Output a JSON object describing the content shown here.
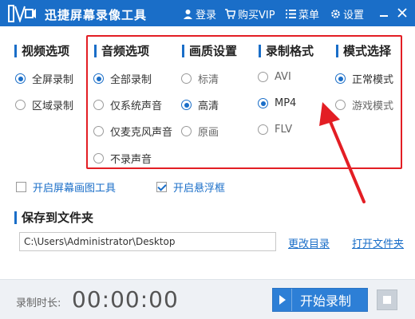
{
  "titlebar": {
    "title": "迅捷屏幕录像工具",
    "login": "登录",
    "vip": "购买VIP",
    "menu": "菜单",
    "settings": "设置"
  },
  "sections": {
    "video": "视频选项",
    "audio": "音频选项",
    "quality": "画质设置",
    "format": "录制格式",
    "mode": "模式选择"
  },
  "video_options": [
    {
      "label": "全屏录制",
      "selected": true
    },
    {
      "label": "区域录制",
      "selected": false
    }
  ],
  "audio_options": [
    {
      "label": "全部录制",
      "selected": true
    },
    {
      "label": "仅系统声音",
      "selected": false
    },
    {
      "label": "仅麦克风声音",
      "selected": false
    },
    {
      "label": "不录声音",
      "selected": false
    }
  ],
  "quality_options": [
    {
      "label": "标清",
      "selected": false
    },
    {
      "label": "高清",
      "selected": true
    },
    {
      "label": "原画",
      "selected": false
    }
  ],
  "format_options": [
    {
      "label": "AVI",
      "selected": false
    },
    {
      "label": "MP4",
      "selected": true
    },
    {
      "label": "FLV",
      "selected": false
    }
  ],
  "mode_options": [
    {
      "label": "正常模式",
      "selected": true
    },
    {
      "label": "游戏模式",
      "selected": false
    }
  ],
  "checkboxes": {
    "draw_tool": {
      "label": "开启屏幕画图工具",
      "checked": false
    },
    "float_window": {
      "label": "开启悬浮框",
      "checked": true
    }
  },
  "folder": {
    "heading": "保存到文件夹",
    "path": "C:\\Users\\Administrator\\Desktop",
    "change": "更改目录",
    "open": "打开文件夹"
  },
  "bottom": {
    "duration_label": "录制时长:",
    "duration": "00:00:00",
    "start": "开始录制"
  },
  "colors": {
    "accent": "#1a6ec8",
    "highlight": "#e31e24"
  }
}
